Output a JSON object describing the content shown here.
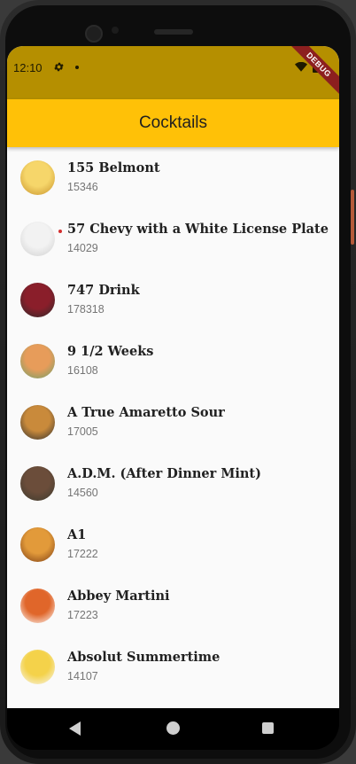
{
  "status_bar": {
    "time": "12:10"
  },
  "debug_banner": "DEBUG",
  "app_bar": {
    "title": "Cocktails"
  },
  "cocktails": [
    {
      "name": "155 Belmont",
      "id": "15346",
      "colors": [
        "#f6d66a",
        "#c6902a"
      ]
    },
    {
      "name": "57 Chevy with a White License Plate",
      "id": "14029",
      "colors": [
        "#f2f2f2",
        "#cfcfcf"
      ]
    },
    {
      "name": "747 Drink",
      "id": "178318",
      "colors": [
        "#8a1e2a",
        "#2a2a2a"
      ]
    },
    {
      "name": "9 1/2 Weeks",
      "id": "16108",
      "colors": [
        "#e79c5a",
        "#6aa06b"
      ]
    },
    {
      "name": "A True Amaretto Sour",
      "id": "17005",
      "colors": [
        "#c98a3b",
        "#2e2e2e"
      ]
    },
    {
      "name": "A.D.M. (After Dinner Mint)",
      "id": "14560",
      "colors": [
        "#6b4d3a",
        "#3a3a2e"
      ]
    },
    {
      "name": "A1",
      "id": "17222",
      "colors": [
        "#e29a3a",
        "#7a3b13"
      ]
    },
    {
      "name": "Abbey Martini",
      "id": "17223",
      "colors": [
        "#e0662a",
        "#ffffff"
      ]
    },
    {
      "name": "Absolut Summertime",
      "id": "14107",
      "colors": [
        "#f4d24a",
        "#f7f7f7"
      ]
    }
  ],
  "nav": {
    "back": "back-icon",
    "home": "home-icon",
    "recent": "recent-apps-icon"
  }
}
